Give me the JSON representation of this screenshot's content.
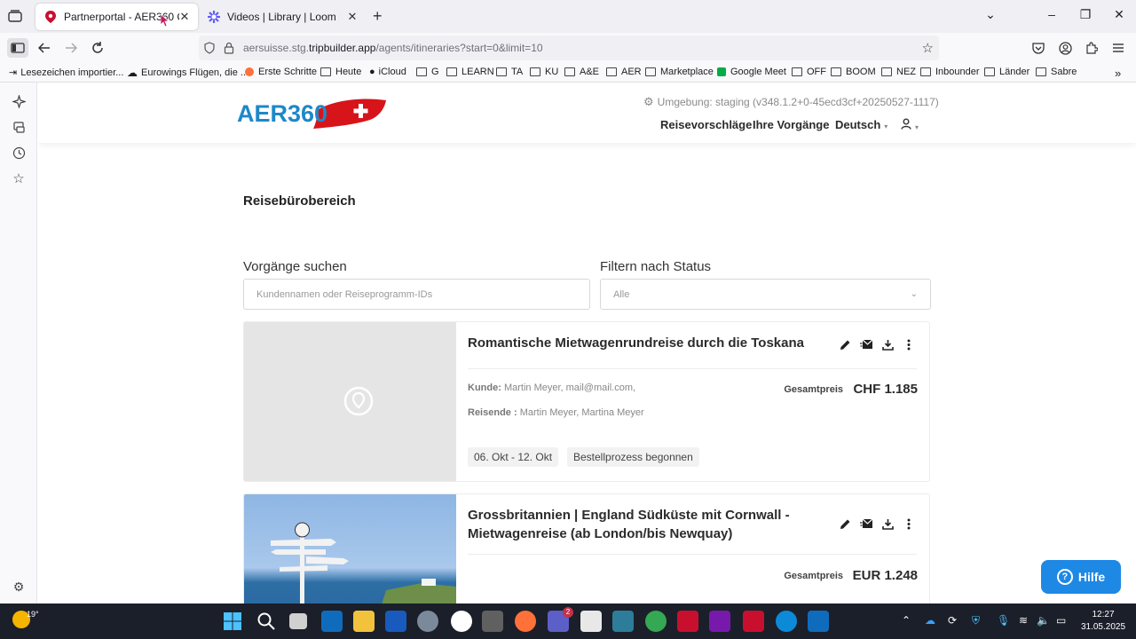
{
  "browser": {
    "tabs": [
      {
        "title": "Partnerportal - AER360 CH"
      },
      {
        "title": "Videos | Library | Loom"
      }
    ],
    "url_prefix": "aersuisse.stg.",
    "url_domain": "tripbuilder.app",
    "url_path": "/agents/itineraries?start=0&limit=10",
    "bookmarks": [
      "Lesezeichen importier...",
      "Eurowings Flügen, die ...",
      "Erste Schritte",
      "Heute",
      "iCloud",
      "G",
      "LEARN",
      "TA",
      "KU",
      "A&E",
      "AER",
      "Marketplace",
      "Google Meet",
      "OFF",
      "BOOM",
      "NEZ",
      "Inbounder",
      "Länder",
      "Sabre"
    ]
  },
  "header": {
    "logo_text": "AER360",
    "environment": "Umgebung: staging (v348.1.2+0-45ecd3cf+20250527-1117)",
    "nav": {
      "proposals": "Reisevorschläge",
      "bookings": "Ihre Vorgänge",
      "language": "Deutsch"
    }
  },
  "main": {
    "section_title": "Reisebürobereich",
    "search": {
      "label": "Vorgänge suchen",
      "placeholder": "Kundennamen oder Reiseprogramm-IDs"
    },
    "filter": {
      "label": "Filtern nach Status",
      "selected": "Alle"
    },
    "cards": [
      {
        "title": "Romantische Mietwagenrundreise durch die Toskana",
        "customer_label": "Kunde:",
        "customer": "Martin Meyer, mail@mail.com,",
        "travellers_label": "Reisende :",
        "travellers": "Martin Meyer, Martina Meyer",
        "total_label": "Gesamtpreis",
        "price": "CHF 1.185",
        "dates": "06. Okt - 12. Okt",
        "status": "Bestellprozess begonnen"
      },
      {
        "title_line1": "Grossbritannien | England Südküste mit Cornwall -",
        "title_line2": "Mietwagenreise (ab London/bis Newquay)",
        "total_label": "Gesamtpreis",
        "price": "EUR 1.248"
      }
    ]
  },
  "help_button": "Hilfe",
  "taskbar": {
    "temperature": "19°",
    "time": "12:27",
    "date": "31.05.2025",
    "teams_badge": "2"
  },
  "colors": {
    "logo_blue": "#1e88c8",
    "logo_red": "#d7141a",
    "help_blue": "#1e88e5"
  }
}
